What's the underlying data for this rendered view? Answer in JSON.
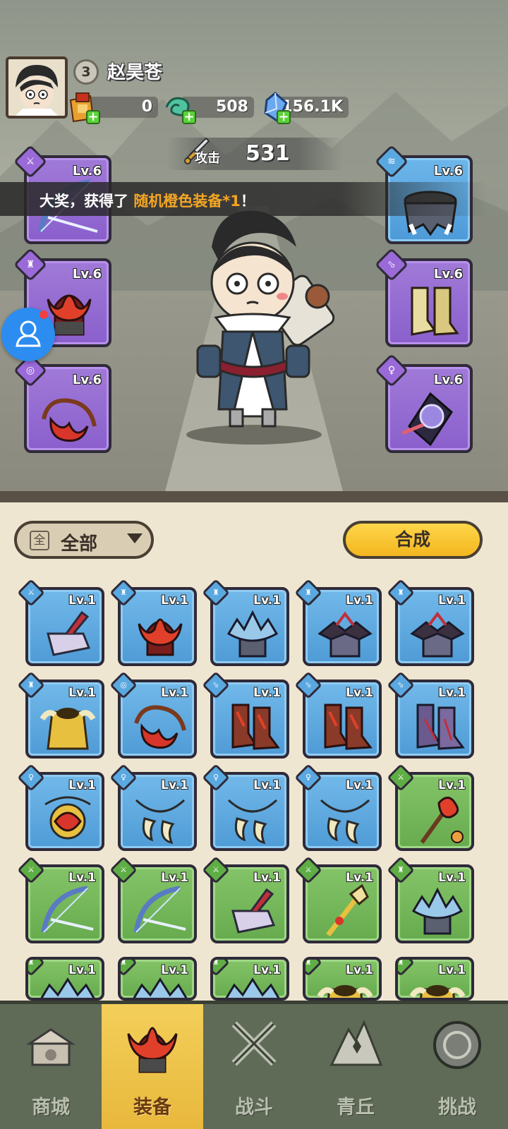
{
  "player": {
    "level": "3",
    "name": "赵昊苍"
  },
  "resources": [
    {
      "icon": "scroll-bag-icon",
      "value": "0"
    },
    {
      "icon": "jade-dragon-icon",
      "value": "508"
    },
    {
      "icon": "crystal-icon",
      "value": "156.1K"
    }
  ],
  "attack": {
    "label": "攻击",
    "value": "531"
  },
  "banner": {
    "prefix": "大奖，获得了 ",
    "highlight": "随机橙色装备*1",
    "suffix": "！"
  },
  "equipped": [
    {
      "slot": "weapon",
      "icon": "bow-icon",
      "rarity": "purple",
      "level": "Lv.6"
    },
    {
      "slot": "armor",
      "icon": "shoulder-armor-icon",
      "rarity": "blue",
      "level": "Lv.6"
    },
    {
      "slot": "helmet",
      "icon": "flame-helmet-icon",
      "rarity": "purple",
      "level": "Lv.6"
    },
    {
      "slot": "boots",
      "icon": "boots-icon",
      "rarity": "purple",
      "level": "Lv.6"
    },
    {
      "slot": "belt",
      "icon": "belt-icon",
      "rarity": "purple",
      "level": "Lv.6"
    },
    {
      "slot": "amulet",
      "icon": "amulet-icon",
      "rarity": "purple",
      "level": "Lv.6"
    }
  ],
  "inventory_toolbar": {
    "filter_icon": "全",
    "filter_label": "全部",
    "merge_label": "合成"
  },
  "inventory": [
    {
      "icon": "hammer-icon",
      "rarity": "blue",
      "level": "Lv.1"
    },
    {
      "icon": "flame-helmet-icon",
      "rarity": "blue",
      "level": "Lv.1"
    },
    {
      "icon": "ice-helmet-icon",
      "rarity": "blue",
      "level": "Lv.1"
    },
    {
      "icon": "dark-helmet-icon",
      "rarity": "blue",
      "level": "Lv.1"
    },
    {
      "icon": "dark-helmet-icon",
      "rarity": "blue",
      "level": "Lv.1"
    },
    {
      "icon": "gold-armor-icon",
      "rarity": "blue",
      "level": "Lv.1"
    },
    {
      "icon": "belt-icon",
      "rarity": "blue",
      "level": "Lv.1"
    },
    {
      "icon": "boots-icon",
      "rarity": "blue",
      "level": "Lv.1"
    },
    {
      "icon": "boots-icon",
      "rarity": "blue",
      "level": "Lv.1"
    },
    {
      "icon": "purple-boots-icon",
      "rarity": "blue",
      "level": "Lv.1"
    },
    {
      "icon": "flower-amulet-icon",
      "rarity": "blue",
      "level": "Lv.1"
    },
    {
      "icon": "fang-necklace-icon",
      "rarity": "blue",
      "level": "Lv.1"
    },
    {
      "icon": "fang-necklace-icon",
      "rarity": "blue",
      "level": "Lv.1"
    },
    {
      "icon": "fang-necklace-icon",
      "rarity": "blue",
      "level": "Lv.1"
    },
    {
      "icon": "flower-staff-icon",
      "rarity": "green",
      "level": "Lv.1"
    },
    {
      "icon": "bow-icon",
      "rarity": "green",
      "level": "Lv.1"
    },
    {
      "icon": "bow-icon",
      "rarity": "green",
      "level": "Lv.1"
    },
    {
      "icon": "hammer-icon",
      "rarity": "green",
      "level": "Lv.1"
    },
    {
      "icon": "golden-staff-icon",
      "rarity": "green",
      "level": "Lv.1"
    },
    {
      "icon": "ice-helmet-icon",
      "rarity": "green",
      "level": "Lv.1"
    },
    {
      "icon": "ice-armor-icon",
      "rarity": "green",
      "level": "Lv.1"
    },
    {
      "icon": "ice-armor-icon",
      "rarity": "green",
      "level": "Lv.1"
    },
    {
      "icon": "ice-armor-icon",
      "rarity": "green",
      "level": "Lv.1"
    },
    {
      "icon": "gold-armor-icon",
      "rarity": "green",
      "level": "Lv.1"
    },
    {
      "icon": "gold-armor-icon",
      "rarity": "green",
      "level": "Lv.1"
    }
  ],
  "nav": [
    {
      "label": "商城",
      "icon": "shop-icon",
      "active": false
    },
    {
      "label": "装备",
      "icon": "equipment-icon",
      "active": true
    },
    {
      "label": "战斗",
      "icon": "crossed-swords-icon",
      "active": false
    },
    {
      "label": "青丘",
      "icon": "mountain-icon",
      "active": false
    },
    {
      "label": "挑战",
      "icon": "challenge-orb-icon",
      "active": false
    }
  ],
  "colors": {
    "purple": "#8a5fcc",
    "blue": "#4f9bd6",
    "green": "#67ab4e",
    "highlight": "#f5a623",
    "merge": "#f3b61f"
  }
}
